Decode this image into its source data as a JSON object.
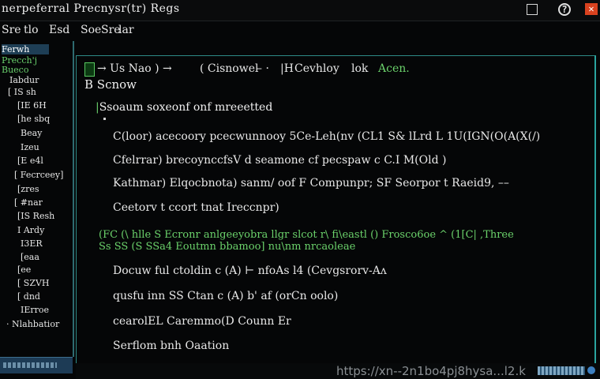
{
  "window": {
    "title": "nerpeferral Precnysr(tr) Regs",
    "buttons": {
      "minimize": "",
      "help": "?",
      "close": "✕"
    },
    "icons": {
      "minimize": "minimize-icon",
      "help": "help-icon",
      "close": "close-icon"
    }
  },
  "menu": [
    "Sre",
    "tlo",
    "Esd",
    "Soe",
    "Sre",
    "lar"
  ],
  "sidebar": {
    "items": [
      {
        "label": "Ferwh",
        "state": "selected"
      },
      {
        "label": "Precch'j",
        "state": "normal"
      },
      {
        "label": "Bueco",
        "state": "normal"
      },
      {
        "label": "Iabdur",
        "state": "normal"
      },
      {
        "label": "[ IS sh",
        "state": "normal"
      },
      {
        "label": "[IE 6H",
        "state": "normal"
      },
      {
        "label": "[he sbq",
        "state": "normal"
      },
      {
        "label": "Beay",
        "state": "normal"
      },
      {
        "label": "Izeu",
        "state": "normal"
      },
      {
        "label": "[E e4l",
        "state": "normal"
      },
      {
        "label": "[ Fecrceey]",
        "state": "normal"
      },
      {
        "label": "[zres",
        "state": "normal"
      },
      {
        "label": "[ #nar",
        "state": "normal"
      },
      {
        "label": "[IS Resh",
        "state": "normal"
      },
      {
        "label": "I Ardy",
        "state": "normal"
      },
      {
        "label": "I3ER",
        "state": "normal"
      },
      {
        "label": "[eaa",
        "state": "normal"
      },
      {
        "label": "[ee",
        "state": "normal"
      },
      {
        "label": "[ SZVH",
        "state": "normal"
      },
      {
        "label": "[ dnd",
        "state": "normal"
      },
      {
        "label": "IErroe",
        "state": "normal"
      },
      {
        "label": "· Nlahbatior",
        "state": "normal"
      }
    ]
  },
  "terminal": {
    "path": {
      "segments": [
        "→ Us Nao ) →",
        "( Cisnowel",
        "– ·",
        "|H",
        "Cevhloy",
        "lok",
        "Acen."
      ]
    },
    "prompt": "B  Scnow",
    "section_title": "Ssoaum  soxeonf  onf  mreeetted",
    "lines": [
      "C(loor)  acecoory  pcecwunnooy  5Ce-Leh(nv  (CL1  S&  lLrd   L    1U(IGN(O(A(X(/)",
      "Cfelrrar)  brecoynccfsV  d  seamone  cf  pecspaw  c  C.I  M(Old  )",
      "Kathmar)  Elqocbnota)  sanm/  oof  F  Compunpr;  SF  Seorpor  t  Raeid9,  ––",
      "Ceetorv  t  ccort  tnat  Ireccnpr)",
      "Docuw  ful  ctoldin  c  (A)  ⊢  nfoAs  l4  (Cevgsrorv-Aʌ",
      "qusfu  inn  SS  Ctan  c  (A)  b'  af  (orCn  oolo)",
      "cearolEL   Caremmo(D   Counn  Er",
      "Serflom  bnh  Oaation"
    ],
    "green_lines": [
      "(FC (\\  hlle  S Ecronr  anlgeeyobra  llgr  slcot  r\\  fi\\eastl  ()  Frosco6oe  ^  (1[C|  ,Three",
      "Ss  SS  (S  SSa4  Eoutmn  bbamoo]  nu\\nm  nrcaoleae"
    ],
    "status_url": "https://xn--2n1bo4pj8hysa...l2.k"
  }
}
